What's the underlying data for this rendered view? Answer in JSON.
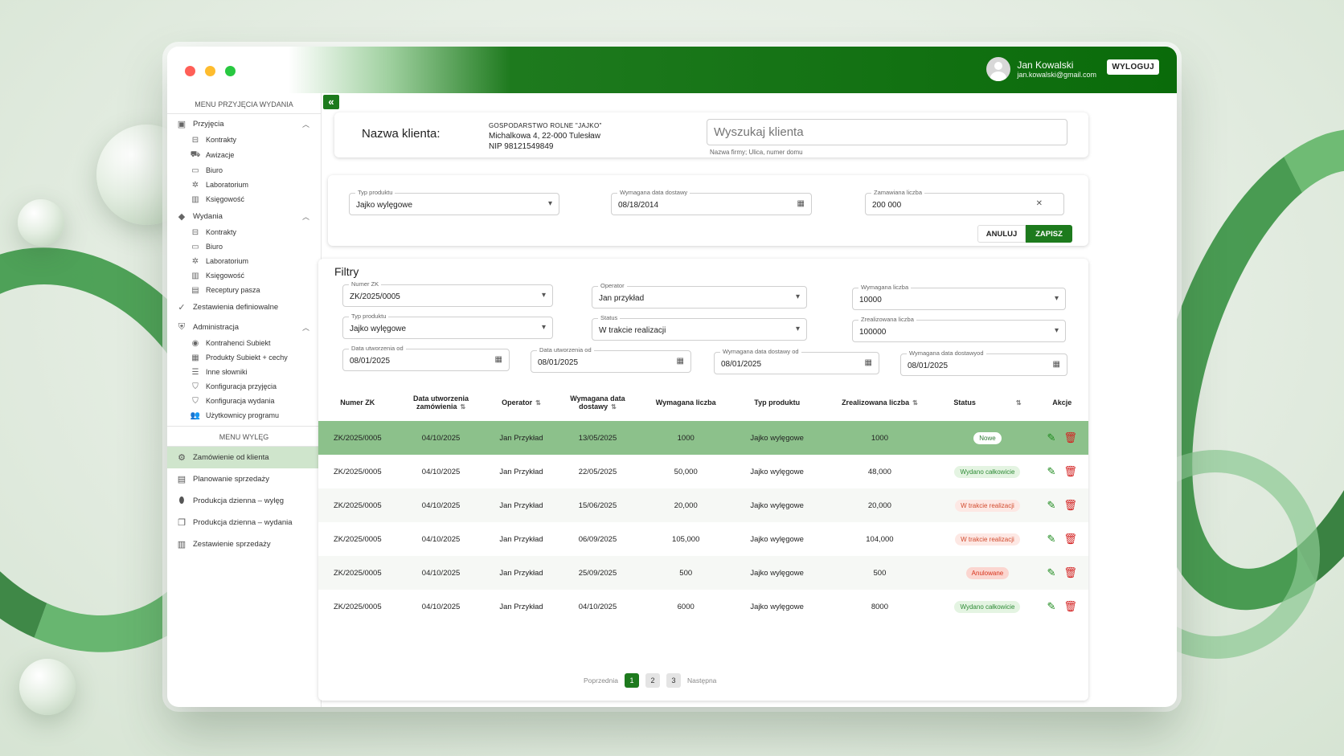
{
  "colors": {
    "brand_green": "#1d7a1d",
    "row_highlight": "#8cc18b",
    "status_new_bg": "#eef6ec",
    "status_new_fg": "#2f7a34",
    "status_done_bg": "#e4f4e2",
    "status_done_fg": "#2e8b36",
    "status_progress_bg": "#fde8e4",
    "status_progress_fg": "#d24b2e",
    "status_cancel_bg": "#fbd6d0",
    "status_cancel_fg": "#d8331b"
  },
  "header": {
    "user_name": "Jan Kowalski",
    "user_email": "jan.kowalski@gmail.com",
    "logout_label": "WYLOGUJ"
  },
  "sidebar": {
    "menu1_title": "MENU PRZYJĘCIA WYDANIA",
    "przyjecia": {
      "label": "Przyjęcia",
      "items": [
        "Kontrakty",
        "Awizacje",
        "Biuro",
        "Laboratorium",
        "Księgowość"
      ]
    },
    "wydania": {
      "label": "Wydania",
      "items": [
        "Kontrakty",
        "Biuro",
        "Laboratorium",
        "Księgowość",
        "Receptury pasza"
      ]
    },
    "zestawienia": "Zestawienia definiowalne",
    "administracja": {
      "label": "Administracja",
      "items": [
        "Kontrahenci Subiekt",
        "Produkty Subiekt + cechy",
        "Inne słowniki",
        "Konfiguracja przyjęcia",
        "Konfiguracja wydania",
        "Użytkownicy programu"
      ]
    },
    "menu2_title": "MENU WYLĘG",
    "wyleg_items": [
      "Zamówienie od klienta",
      "Planowanie sprzedaży",
      "Produkcja dzienna – wylęg",
      "Produkcja dzienna – wydania",
      "Zestawienie sprzedaży"
    ]
  },
  "client": {
    "label": "Nazwa klienta:",
    "company": "GOSPODARSTWO ROLNE \"JAJKO\"",
    "address": "Michalkowa 4, 22-000 Tulesław",
    "nip": "NIP 98121549849",
    "search_placeholder": "Wyszukaj klienta",
    "search_hint": "Nazwa firmy; Ulica, numer domu"
  },
  "order_form": {
    "product_label": "Typ produktu",
    "product_value": "Jajko wylęgowe",
    "date_label": "Wymagana data dostawy",
    "date_value": "08/18/2014",
    "qty_label": "Zamawiana liczba",
    "qty_value": "200 000",
    "cancel_label": "ANULUJ",
    "save_label": "ZAPISZ"
  },
  "filters": {
    "title": "Filtry",
    "numer_zk_label": "Numer ZK",
    "numer_zk_value": "ZK/2025/0005",
    "operator_label": "Operator",
    "operator_value": "Jan przykład",
    "wym_liczba_label": "Wymagana liczba",
    "wym_liczba_value": "10000",
    "typ_label": "Typ produktu",
    "typ_value": "Jajko wylęgowe",
    "status_label": "Status",
    "status_value": "W trakcie realizacji",
    "zreal_label": "Zrealizowana liczba",
    "zreal_value": "100000",
    "date1_label": "Data utworzenia od",
    "date1_value": "08/01/2025",
    "date2_label": "Data utworzenia od",
    "date2_value": "08/01/2025",
    "date3_label": "Wymagana data dostawy od",
    "date3_value": "08/01/2025",
    "date4_label": "Wymagana data dostawyod",
    "date4_value": "08/01/2025"
  },
  "table": {
    "headers": [
      "Numer ZK",
      "Data utworzenia zamówienia",
      "Operator",
      "Wymagana data dostawy",
      "Wymagana liczba",
      "Typ produktu",
      "Zrealizowana liczba",
      "Status",
      "Akcje"
    ],
    "rows": [
      [
        "ZK/2025/0005",
        "04/10/2025",
        "Jan Przykład",
        "13/05/2025",
        "1000",
        "Jajko wylęgowe",
        "1000",
        "Nowe"
      ],
      [
        "ZK/2025/0005",
        "04/10/2025",
        "Jan Przykład",
        "22/05/2025",
        "50,000",
        "Jajko wylęgowe",
        "48,000",
        "Wydano całkowicie"
      ],
      [
        "ZK/2025/0005",
        "04/10/2025",
        "Jan Przykład",
        "15/06/2025",
        "20,000",
        "Jajko wylęgowe",
        "20,000",
        "W trakcie realizacji"
      ],
      [
        "ZK/2025/0005",
        "04/10/2025",
        "Jan Przykład",
        "06/09/2025",
        "105,000",
        "Jajko wylęgowe",
        "104,000",
        "W trakcie realizacji"
      ],
      [
        "ZK/2025/0005",
        "04/10/2025",
        "Jan Przykład",
        "25/09/2025",
        "500",
        "Jajko wylęgowe",
        "500",
        "Anulowane"
      ],
      [
        "ZK/2025/0005",
        "04/10/2025",
        "Jan Przykład",
        "04/10/2025",
        "6000",
        "Jajko wylęgowe",
        "8000",
        "Wydano całkowicie"
      ]
    ]
  },
  "pagination": {
    "prev": "Poprzednia",
    "pages": [
      "1",
      "2",
      "3"
    ],
    "next": "Następna"
  }
}
